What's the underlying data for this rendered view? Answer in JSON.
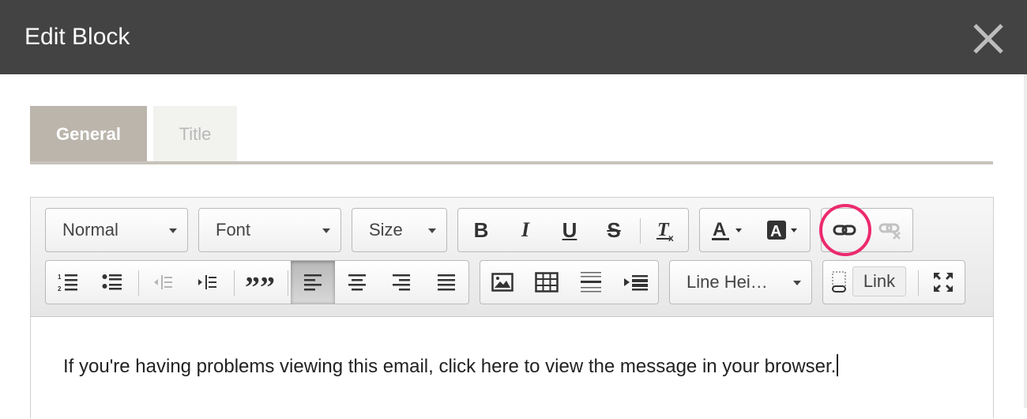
{
  "dialog": {
    "title": "Edit Block"
  },
  "tabs": [
    {
      "label": "General",
      "active": true
    },
    {
      "label": "Title",
      "active": false
    }
  ],
  "toolbar": {
    "format_select": "Normal",
    "font_select": "Font",
    "size_select": "Size",
    "line_height_select": "Line Hei…",
    "link_tooltip": "Link",
    "icons": [
      "bold-icon",
      "italic-icon",
      "underline-icon",
      "strikethrough-icon",
      "remove-format-icon",
      "text-color-icon",
      "background-color-icon",
      "link-icon",
      "unlink-icon",
      "numbered-list-icon",
      "bulleted-list-icon",
      "decrease-indent-icon",
      "increase-indent-icon",
      "blockquote-icon",
      "align-left-icon",
      "align-center-icon",
      "align-right-icon",
      "justify-icon",
      "image-icon",
      "table-icon",
      "horizontal-line-icon",
      "indent-block-icon",
      "anchor-icon",
      "maximize-icon"
    ]
  },
  "editor": {
    "content": "If you're having problems viewing this email, click here to view the message in your browser."
  },
  "colors": {
    "header": "#434343",
    "active_tab": "#bbb5ac",
    "highlight": "#ec2a6e"
  }
}
